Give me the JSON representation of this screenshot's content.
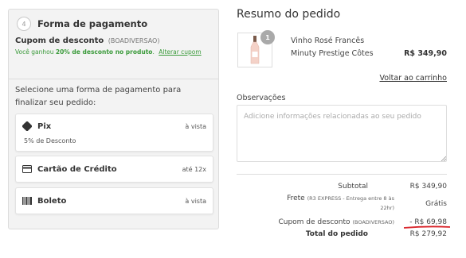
{
  "payment": {
    "step_number": "4",
    "title": "Forma de pagamento",
    "coupon": {
      "title": "Cupom de desconto",
      "code": "(BOADIVERSAO)",
      "msg_prefix": "Você ganhou",
      "msg_highlight": "20% de desconto no produto",
      "msg_suffix": ".",
      "change_link": "Alterar cupom"
    },
    "prompt": "Selecione uma forma de pagamento para finalizar seu pedido:",
    "options": [
      {
        "name": "Pix",
        "sub": "5% de Desconto",
        "right": "à vista",
        "icon": "pix-icon"
      },
      {
        "name": "Cartão de Crédito",
        "sub": "",
        "right": "até 12x",
        "icon": "credit-card-icon"
      },
      {
        "name": "Boleto",
        "sub": "",
        "right": "à vista",
        "icon": "barcode-icon"
      }
    ]
  },
  "summary": {
    "title": "Resumo do pedido",
    "product": {
      "quantity": "1",
      "name_line1": "Vinho Rosé Francês",
      "name_line2": "Minuty Prestige Côtes",
      "price": "R$ 349,90"
    },
    "back_link": "Voltar ao carrinho",
    "observations_label": "Observações",
    "observations_placeholder": "Adicione informações relacionadas ao seu pedido",
    "subtotal_label": "Subtotal",
    "subtotal_value": "R$ 349,90",
    "frete_label": "Frete",
    "frete_note_line1": "(R3 EXPRESS - Entrega entre 8 às",
    "frete_note_line2": "22hr)",
    "frete_value": "Grátis",
    "coupon_label": "Cupom de desconto",
    "coupon_code": "(BOADIVERSAO)",
    "coupon_value": "- R$ 69,98",
    "total_label": "Total do pedido",
    "total_value": "R$ 279,92"
  },
  "colors": {
    "success_green": "#3a9a3a",
    "highlight_red": "#d9262c"
  }
}
